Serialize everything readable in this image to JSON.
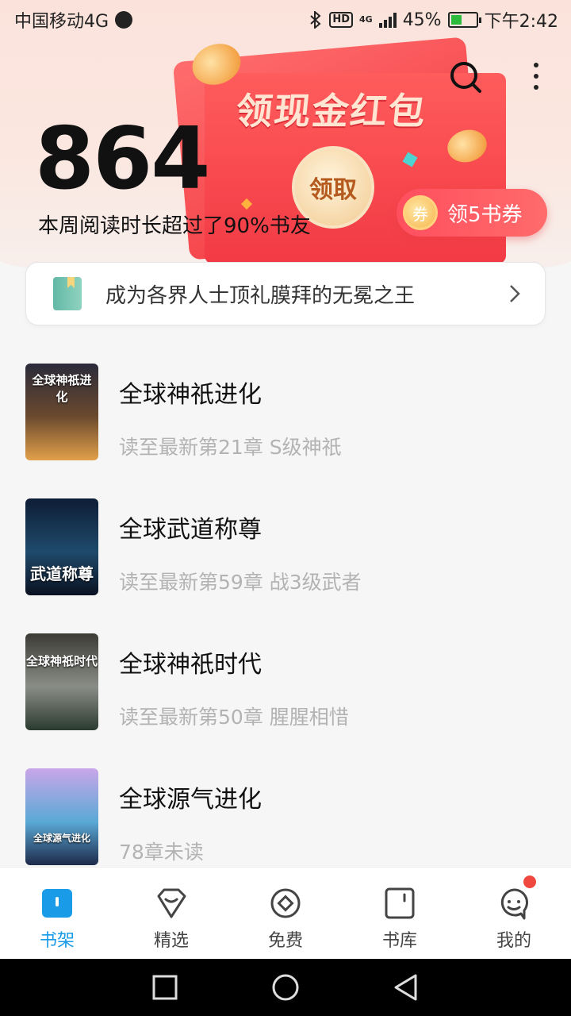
{
  "status_bar": {
    "carrier": "中国移动4G",
    "hd_label": "HD",
    "network_label": "4G",
    "battery_percent": "45%",
    "battery_level": 0.45,
    "time": "下午2:42"
  },
  "header": {
    "read_minutes": "864",
    "read_description": "本周阅读时长超过了90%书友"
  },
  "red_packet": {
    "title": "领现金红包",
    "claim_label": "领取",
    "voucher_icon_text": "券",
    "voucher_label": "领5书券"
  },
  "promo": {
    "text": "成为各界人士顶礼膜拜的无冕之王"
  },
  "books": [
    {
      "title": "全球神祇进化",
      "progress": "读至最新第21章 S级神祇",
      "cover_text": "全球神祇进化",
      "cover_colors": [
        "#2b2a3a",
        "#6b4a2e",
        "#e2a04a"
      ]
    },
    {
      "title": "全球武道称尊",
      "progress": "读至最新第59章 战3级武者",
      "cover_text": "武道称尊",
      "cover_colors": [
        "#0e1d35",
        "#1f4a6b",
        "#0a1222"
      ]
    },
    {
      "title": "全球神祇时代",
      "progress": "读至最新第50章 腥腥相惜",
      "cover_text": "全球神祇时代",
      "cover_colors": [
        "#3c3b35",
        "#8a8d87",
        "#2b3b2f"
      ]
    },
    {
      "title": "全球源气进化",
      "progress": "78章未读",
      "cover_text": "全球源气进化",
      "cover_colors": [
        "#c9a6e8",
        "#5aa9d6",
        "#1d2a4a"
      ]
    }
  ],
  "bottom_nav": [
    {
      "label": "书架",
      "icon": "bookshelf-icon",
      "active": true
    },
    {
      "label": "精选",
      "icon": "gem-icon",
      "active": false
    },
    {
      "label": "免费",
      "icon": "coin-icon",
      "active": false
    },
    {
      "label": "书库",
      "icon": "library-icon",
      "active": false
    },
    {
      "label": "我的",
      "icon": "profile-icon",
      "active": false
    }
  ],
  "colors": {
    "accent": "#1a9be8",
    "red_packet": "#f23a44",
    "notification_dot": "#f0483f"
  }
}
